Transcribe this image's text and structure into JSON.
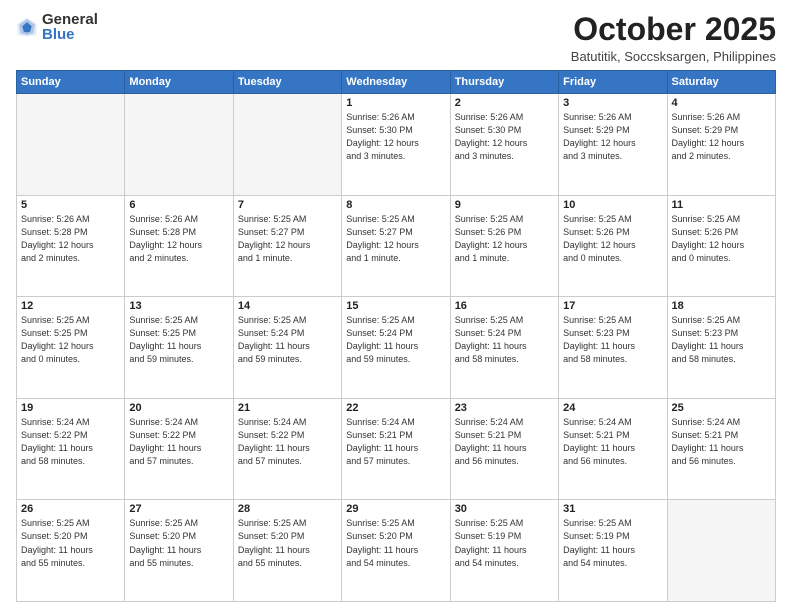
{
  "logo": {
    "general": "General",
    "blue": "Blue"
  },
  "title": "October 2025",
  "location": "Batutitik, Soccsksargen, Philippines",
  "weekdays": [
    "Sunday",
    "Monday",
    "Tuesday",
    "Wednesday",
    "Thursday",
    "Friday",
    "Saturday"
  ],
  "weeks": [
    [
      {
        "day": "",
        "info": ""
      },
      {
        "day": "",
        "info": ""
      },
      {
        "day": "",
        "info": ""
      },
      {
        "day": "1",
        "info": "Sunrise: 5:26 AM\nSunset: 5:30 PM\nDaylight: 12 hours\nand 3 minutes."
      },
      {
        "day": "2",
        "info": "Sunrise: 5:26 AM\nSunset: 5:30 PM\nDaylight: 12 hours\nand 3 minutes."
      },
      {
        "day": "3",
        "info": "Sunrise: 5:26 AM\nSunset: 5:29 PM\nDaylight: 12 hours\nand 3 minutes."
      },
      {
        "day": "4",
        "info": "Sunrise: 5:26 AM\nSunset: 5:29 PM\nDaylight: 12 hours\nand 2 minutes."
      }
    ],
    [
      {
        "day": "5",
        "info": "Sunrise: 5:26 AM\nSunset: 5:28 PM\nDaylight: 12 hours\nand 2 minutes."
      },
      {
        "day": "6",
        "info": "Sunrise: 5:26 AM\nSunset: 5:28 PM\nDaylight: 12 hours\nand 2 minutes."
      },
      {
        "day": "7",
        "info": "Sunrise: 5:25 AM\nSunset: 5:27 PM\nDaylight: 12 hours\nand 1 minute."
      },
      {
        "day": "8",
        "info": "Sunrise: 5:25 AM\nSunset: 5:27 PM\nDaylight: 12 hours\nand 1 minute."
      },
      {
        "day": "9",
        "info": "Sunrise: 5:25 AM\nSunset: 5:26 PM\nDaylight: 12 hours\nand 1 minute."
      },
      {
        "day": "10",
        "info": "Sunrise: 5:25 AM\nSunset: 5:26 PM\nDaylight: 12 hours\nand 0 minutes."
      },
      {
        "day": "11",
        "info": "Sunrise: 5:25 AM\nSunset: 5:26 PM\nDaylight: 12 hours\nand 0 minutes."
      }
    ],
    [
      {
        "day": "12",
        "info": "Sunrise: 5:25 AM\nSunset: 5:25 PM\nDaylight: 12 hours\nand 0 minutes."
      },
      {
        "day": "13",
        "info": "Sunrise: 5:25 AM\nSunset: 5:25 PM\nDaylight: 11 hours\nand 59 minutes."
      },
      {
        "day": "14",
        "info": "Sunrise: 5:25 AM\nSunset: 5:24 PM\nDaylight: 11 hours\nand 59 minutes."
      },
      {
        "day": "15",
        "info": "Sunrise: 5:25 AM\nSunset: 5:24 PM\nDaylight: 11 hours\nand 59 minutes."
      },
      {
        "day": "16",
        "info": "Sunrise: 5:25 AM\nSunset: 5:24 PM\nDaylight: 11 hours\nand 58 minutes."
      },
      {
        "day": "17",
        "info": "Sunrise: 5:25 AM\nSunset: 5:23 PM\nDaylight: 11 hours\nand 58 minutes."
      },
      {
        "day": "18",
        "info": "Sunrise: 5:25 AM\nSunset: 5:23 PM\nDaylight: 11 hours\nand 58 minutes."
      }
    ],
    [
      {
        "day": "19",
        "info": "Sunrise: 5:24 AM\nSunset: 5:22 PM\nDaylight: 11 hours\nand 58 minutes."
      },
      {
        "day": "20",
        "info": "Sunrise: 5:24 AM\nSunset: 5:22 PM\nDaylight: 11 hours\nand 57 minutes."
      },
      {
        "day": "21",
        "info": "Sunrise: 5:24 AM\nSunset: 5:22 PM\nDaylight: 11 hours\nand 57 minutes."
      },
      {
        "day": "22",
        "info": "Sunrise: 5:24 AM\nSunset: 5:21 PM\nDaylight: 11 hours\nand 57 minutes."
      },
      {
        "day": "23",
        "info": "Sunrise: 5:24 AM\nSunset: 5:21 PM\nDaylight: 11 hours\nand 56 minutes."
      },
      {
        "day": "24",
        "info": "Sunrise: 5:24 AM\nSunset: 5:21 PM\nDaylight: 11 hours\nand 56 minutes."
      },
      {
        "day": "25",
        "info": "Sunrise: 5:24 AM\nSunset: 5:21 PM\nDaylight: 11 hours\nand 56 minutes."
      }
    ],
    [
      {
        "day": "26",
        "info": "Sunrise: 5:25 AM\nSunset: 5:20 PM\nDaylight: 11 hours\nand 55 minutes."
      },
      {
        "day": "27",
        "info": "Sunrise: 5:25 AM\nSunset: 5:20 PM\nDaylight: 11 hours\nand 55 minutes."
      },
      {
        "day": "28",
        "info": "Sunrise: 5:25 AM\nSunset: 5:20 PM\nDaylight: 11 hours\nand 55 minutes."
      },
      {
        "day": "29",
        "info": "Sunrise: 5:25 AM\nSunset: 5:20 PM\nDaylight: 11 hours\nand 54 minutes."
      },
      {
        "day": "30",
        "info": "Sunrise: 5:25 AM\nSunset: 5:19 PM\nDaylight: 11 hours\nand 54 minutes."
      },
      {
        "day": "31",
        "info": "Sunrise: 5:25 AM\nSunset: 5:19 PM\nDaylight: 11 hours\nand 54 minutes."
      },
      {
        "day": "",
        "info": ""
      }
    ]
  ]
}
